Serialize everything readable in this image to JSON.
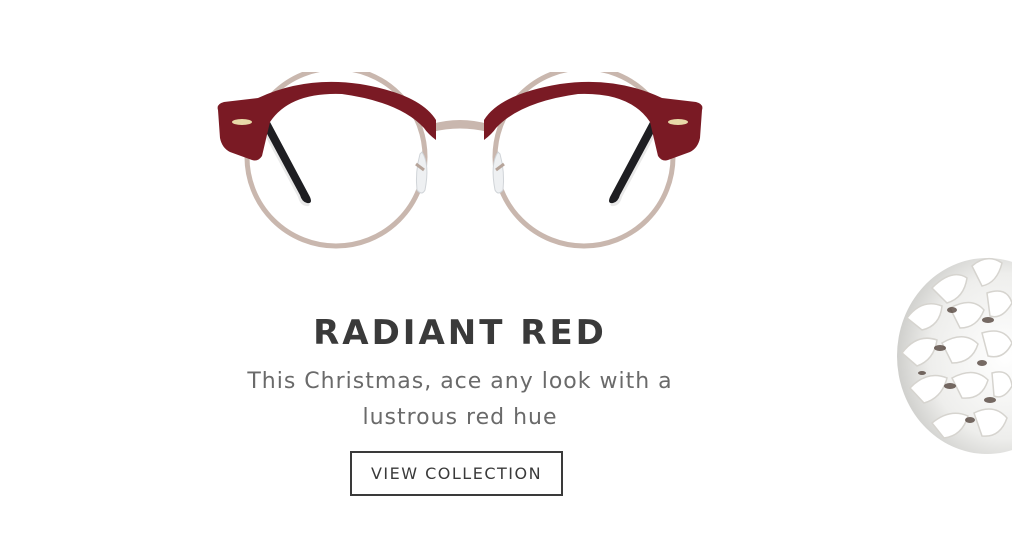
{
  "promo": {
    "title": "RADIANT RED",
    "subtitle": "This Christmas, ace any look  with a\nlustrous red hue",
    "cta_label": "VIEW COLLECTION"
  },
  "colors": {
    "frame_red": "#7a1a24",
    "frame_metal": "#c9b7ae",
    "temple_black": "#1e1e22",
    "text_dark": "#3a3a3a",
    "text_gray": "#6a6a6a"
  },
  "images": {
    "product": "eyeglasses-product-image",
    "decoration": "white-pinecone-decoration"
  }
}
